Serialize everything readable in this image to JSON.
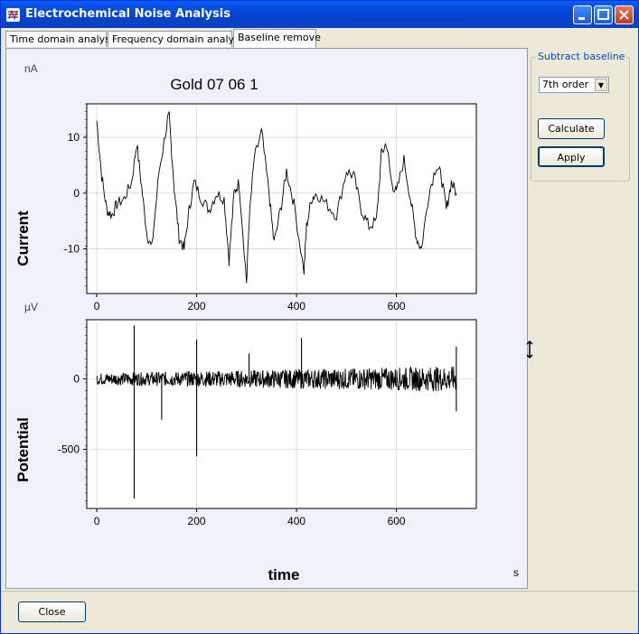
{
  "window": {
    "title": "Electrochemical Noise Analysis",
    "controls": [
      "minimize-icon",
      "maximize-icon",
      "close-icon"
    ]
  },
  "tabs": [
    {
      "label": "Time domain analysis",
      "active": false
    },
    {
      "label": "Frequency domain analysis",
      "active": false
    },
    {
      "label": "Baseline remove",
      "active": true
    }
  ],
  "sidebar": {
    "group_title": "Subtract baseline",
    "order_select": {
      "value": "7th order"
    },
    "calculate_label": "Calculate",
    "apply_label": "Apply"
  },
  "bottom": {
    "close_label": "Close"
  },
  "colors": {
    "panel_bg": "#f0f0fc",
    "trace": "#000000",
    "grid": "#c8c8c8",
    "title_accent": "#0046d5"
  },
  "chart_data": [
    {
      "type": "line",
      "title": "Gold 07 06 1",
      "ylabel": "Current",
      "yunit": "nA",
      "xlabel": "",
      "x_ticks": [
        "0",
        "200",
        "400",
        "600"
      ],
      "y_ticks": [
        "10",
        "0",
        "-10"
      ],
      "xlim": [
        -20,
        760
      ],
      "ylim": [
        -18,
        16
      ],
      "grid": true,
      "series": [
        {
          "x": [
            0,
            10,
            20,
            30,
            40,
            55,
            70,
            80,
            90,
            100,
            110,
            125,
            140,
            145,
            155,
            165,
            175,
            185,
            195,
            210,
            225,
            240,
            255,
            265,
            275,
            285,
            300,
            305,
            315,
            330,
            345,
            355,
            370,
            380,
            395,
            415,
            420,
            430,
            440,
            460,
            480,
            500,
            515,
            530,
            545,
            560,
            570,
            580,
            590,
            600,
            615,
            630,
            640,
            650,
            665,
            680,
            690,
            700,
            710,
            720
          ],
          "values": [
            13,
            3,
            -3,
            -4,
            -2,
            -1,
            2,
            9,
            1,
            -7,
            -10,
            4,
            12,
            14,
            1,
            -8,
            -10,
            -3,
            2,
            -1,
            -3,
            0,
            -1,
            -12,
            0,
            2,
            -16,
            -5,
            6,
            11,
            0,
            -9,
            -2,
            4,
            -2,
            -14,
            -6,
            -1,
            0,
            -2,
            -4,
            4,
            3,
            -3,
            -6,
            -5,
            7,
            9,
            2,
            0,
            6,
            -2,
            -8,
            -10,
            0,
            5,
            3,
            -3,
            2,
            0
          ]
        }
      ]
    },
    {
      "type": "line",
      "title": "",
      "ylabel": "Potential",
      "yunit": "µV",
      "xlabel": "time",
      "xunit": "s",
      "x_ticks": [
        "0",
        "200",
        "400",
        "600"
      ],
      "y_ticks": [
        "0",
        "-500"
      ],
      "xlim": [
        -20,
        760
      ],
      "ylim": [
        -920,
        420
      ],
      "grid": true,
      "series": [
        {
          "x": [
            0,
            720
          ],
          "values": [
            0,
            0
          ],
          "noise_amplitude": 60,
          "spikes": [
            {
              "x": 75,
              "y": 380
            },
            {
              "x": 75,
              "y": -850
            },
            {
              "x": 130,
              "y": -290
            },
            {
              "x": 200,
              "y": 280
            },
            {
              "x": 200,
              "y": -550
            },
            {
              "x": 305,
              "y": 180
            },
            {
              "x": 410,
              "y": 290
            },
            {
              "x": 720,
              "y": 230
            },
            {
              "x": 720,
              "y": -230
            }
          ]
        }
      ]
    }
  ]
}
